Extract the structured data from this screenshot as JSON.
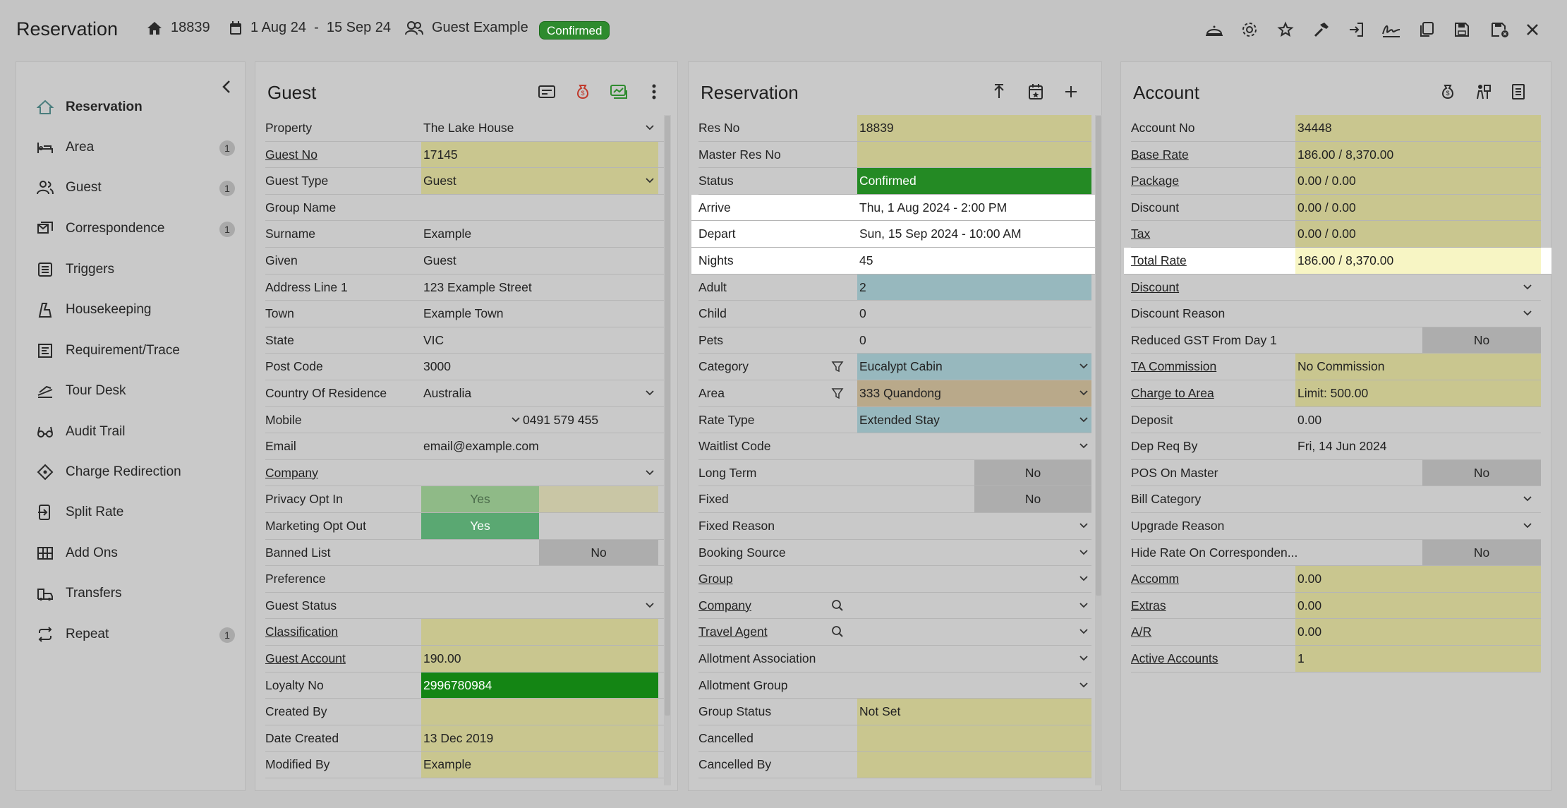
{
  "header": {
    "title": "Reservation",
    "res_no": "18839",
    "dates": "1 Aug 24  -  15 Sep 24",
    "guest": "Guest Example",
    "status": "Confirmed"
  },
  "toolbar_icons": [
    "bell-service-icon",
    "settings-gear-icon",
    "sparkle-star-icon",
    "hammer-icon",
    "sign-in-icon",
    "signature-icon",
    "copy-icon",
    "save-icon",
    "save-close-icon",
    "close-icon"
  ],
  "nav": {
    "items": [
      {
        "label": "Reservation",
        "icon": "house-icon",
        "count": ""
      },
      {
        "label": "Area",
        "icon": "bed-icon",
        "count": "1"
      },
      {
        "label": "Guest",
        "icon": "guests-icon",
        "count": "1"
      },
      {
        "label": "Correspondence",
        "icon": "correspondence-icon",
        "count": "1"
      },
      {
        "label": "Triggers",
        "icon": "triggers-icon",
        "count": ""
      },
      {
        "label": "Housekeeping",
        "icon": "housekeeping-icon",
        "count": ""
      },
      {
        "label": "Requirement/Trace",
        "icon": "requirement-icon",
        "count": ""
      },
      {
        "label": "Tour Desk",
        "icon": "tour-icon",
        "count": ""
      },
      {
        "label": "Audit Trail",
        "icon": "glasses-icon",
        "count": ""
      },
      {
        "label": "Charge Redirection",
        "icon": "redirect-icon",
        "count": ""
      },
      {
        "label": "Split Rate",
        "icon": "split-icon",
        "count": ""
      },
      {
        "label": "Add Ons",
        "icon": "addons-icon",
        "count": ""
      },
      {
        "label": "Transfers",
        "icon": "transfers-icon",
        "count": ""
      },
      {
        "label": "Repeat",
        "icon": "repeat-icon",
        "count": "1"
      }
    ]
  },
  "guest": {
    "title": "Guest",
    "rows": [
      {
        "label": "Property",
        "value": "The Lake House"
      },
      {
        "label": "Guest No",
        "value": "17145"
      },
      {
        "label": "Guest Type",
        "value": "Guest"
      },
      {
        "label": "Group Name",
        "value": ""
      },
      {
        "label": "Surname",
        "value": "Example"
      },
      {
        "label": "Given",
        "value": "Guest"
      },
      {
        "label": "Address Line 1",
        "value": "123 Example Street"
      },
      {
        "label": "Town",
        "value": "Example Town"
      },
      {
        "label": "State",
        "value": "VIC"
      },
      {
        "label": "Post Code",
        "value": "3000"
      },
      {
        "label": "Country Of Residence",
        "value": "Australia"
      },
      {
        "label": "Mobile",
        "value": "0491 579 455"
      },
      {
        "label": "Email",
        "value": "email@example.com"
      },
      {
        "label": "Company",
        "value": ""
      },
      {
        "label": "Privacy Opt In",
        "value": "Yes"
      },
      {
        "label": "Marketing Opt Out",
        "value": "Yes"
      },
      {
        "label": "Banned List",
        "value": "No"
      },
      {
        "label": "Preference",
        "value": ""
      },
      {
        "label": "Guest Status",
        "value": ""
      },
      {
        "label": "Classification",
        "value": ""
      },
      {
        "label": "Guest Account",
        "value": "190.00"
      },
      {
        "label": "Loyalty No",
        "value": "2996780984"
      },
      {
        "label": "Created By",
        "value": ""
      },
      {
        "label": "Date Created",
        "value": "13 Dec 2019"
      },
      {
        "label": "Modified By",
        "value": "Example"
      }
    ]
  },
  "reservation": {
    "title": "Reservation",
    "rows": [
      {
        "label": "Res No",
        "value": "18839"
      },
      {
        "label": "Master Res No",
        "value": ""
      },
      {
        "label": "Status",
        "value": "Confirmed"
      },
      {
        "label": "Arrive",
        "value": "Thu, 1 Aug 2024 - 2:00 PM"
      },
      {
        "label": "Depart",
        "value": "Sun, 15 Sep 2024 - 10:00 AM"
      },
      {
        "label": "Nights",
        "value": "45"
      },
      {
        "label": "Adult",
        "value": "2"
      },
      {
        "label": "Child",
        "value": "0"
      },
      {
        "label": "Pets",
        "value": "0"
      },
      {
        "label": "Category",
        "value": "Eucalypt Cabin"
      },
      {
        "label": "Area",
        "value": "333 Quandong"
      },
      {
        "label": "Rate Type",
        "value": "Extended Stay"
      },
      {
        "label": "Waitlist Code",
        "value": ""
      },
      {
        "label": "Long Term",
        "value": "No"
      },
      {
        "label": "Fixed",
        "value": "No"
      },
      {
        "label": "Fixed Reason",
        "value": ""
      },
      {
        "label": "Booking Source",
        "value": ""
      },
      {
        "label": "Group",
        "value": ""
      },
      {
        "label": "Company",
        "value": ""
      },
      {
        "label": "Travel Agent",
        "value": ""
      },
      {
        "label": "Allotment Association",
        "value": ""
      },
      {
        "label": "Allotment Group",
        "value": ""
      },
      {
        "label": "Group Status",
        "value": "Not Set"
      },
      {
        "label": "Cancelled",
        "value": ""
      },
      {
        "label": "Cancelled By",
        "value": ""
      }
    ]
  },
  "account": {
    "title": "Account",
    "rows": [
      {
        "label": "Account No",
        "value": "34448"
      },
      {
        "label": "Base Rate",
        "value": "186.00 / 8,370.00"
      },
      {
        "label": "Package",
        "value": "0.00 / 0.00"
      },
      {
        "label": "Discount",
        "value": "0.00 / 0.00"
      },
      {
        "label": "Tax",
        "value": "0.00 / 0.00"
      },
      {
        "label": "Total Rate",
        "value": "186.00 / 8,370.00"
      },
      {
        "label": "Discount",
        "value": ""
      },
      {
        "label": "Discount Reason",
        "value": ""
      },
      {
        "label": "Reduced GST From Day 1",
        "value": "No"
      },
      {
        "label": "TA Commission",
        "value": "No Commission"
      },
      {
        "label": "Charge to Area",
        "value": "Limit: 500.00"
      },
      {
        "label": "Deposit",
        "value": "0.00"
      },
      {
        "label": "Dep Req By",
        "value": "Fri, 14 Jun 2024"
      },
      {
        "label": "POS On Master",
        "value": "No"
      },
      {
        "label": "Bill Category",
        "value": ""
      },
      {
        "label": "Upgrade Reason",
        "value": ""
      },
      {
        "label": "Hide Rate On Corresponden...",
        "value": "No"
      },
      {
        "label": "Accomm",
        "value": "0.00"
      },
      {
        "label": "Extras",
        "value": "0.00"
      },
      {
        "label": "A/R",
        "value": "0.00"
      },
      {
        "label": "Active Accounts",
        "value": "1"
      }
    ]
  },
  "colors": {
    "confirmed_badge": "#2e8b2e",
    "field_yellow": "#c9c68f",
    "status_green": "#248a24",
    "loyalty_green": "#148514",
    "teal": "#97b8be",
    "tan": "#b9a98a",
    "highlight_yellow": "#f7f5c4"
  }
}
